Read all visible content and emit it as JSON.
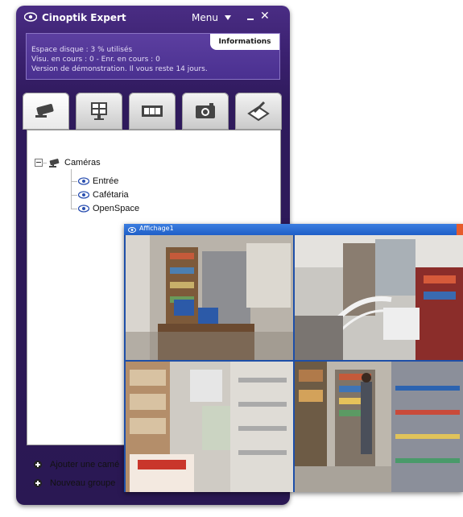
{
  "app": {
    "title": "Cinoptik Expert",
    "menu_label": "Menu",
    "minimize": "–",
    "close": "✕"
  },
  "info": {
    "tab_label": "Informations",
    "lines": [
      "Espace disque : 3 % utilisés",
      "Visu. en cours : 0 - Enr. en cours : 0",
      "Version de démonstration. Il vous reste 14 jours."
    ]
  },
  "toolbar": {
    "items": [
      "camera-icon",
      "monitor-grid-icon",
      "film-strip-icon",
      "photo-camera-icon",
      "edit-tool-icon"
    ]
  },
  "tree": {
    "root": "Caméras",
    "children": [
      "Entrée",
      "Cafétaria",
      "OpenSpace"
    ]
  },
  "bottom": {
    "add_camera": "Ajouter une camé",
    "new_group": "Nouveau groupe"
  },
  "video_window": {
    "title": "Affichage1"
  },
  "colors": {
    "window_purple": "#3b2170",
    "video_title_blue": "#1f5fc7"
  }
}
